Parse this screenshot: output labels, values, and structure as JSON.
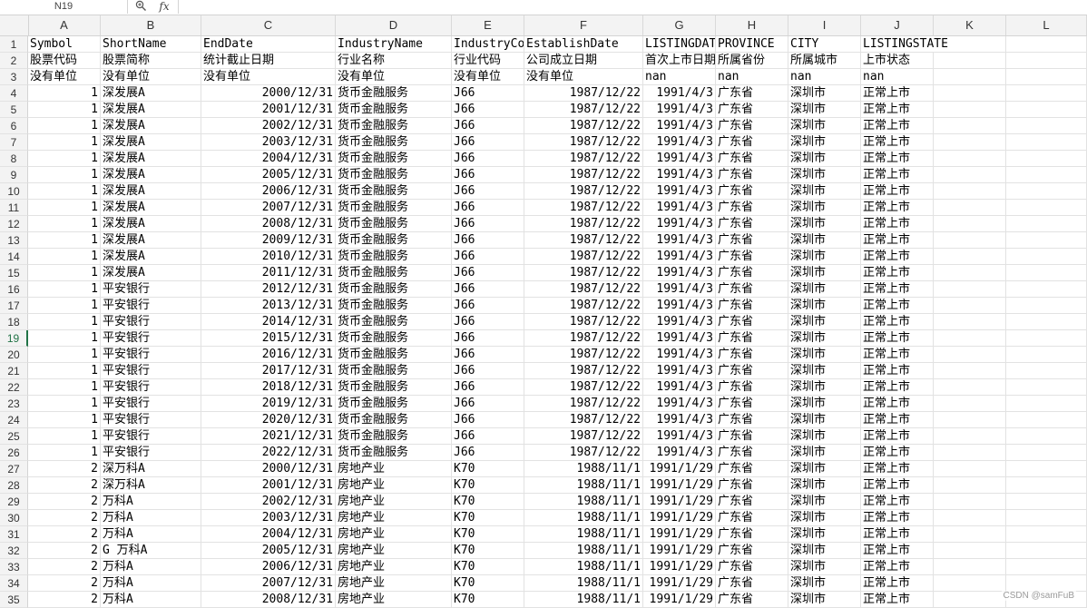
{
  "formula_bar": {
    "name_box": "N19",
    "zoom_icon": "zoom-icon",
    "fx_label": "fx",
    "value": ""
  },
  "columns": [
    "A",
    "B",
    "C",
    "D",
    "E",
    "F",
    "G",
    "H",
    "I",
    "J",
    "K",
    "L"
  ],
  "selected_row": 19,
  "watermark": "CSDN @samFuB",
  "rows": [
    [
      "Symbol",
      "ShortName",
      "EndDate",
      "IndustryName",
      "IndustryCode",
      "EstablishDate",
      "LISTINGDATE",
      "PROVINCE",
      "CITY",
      "LISTINGSTATE"
    ],
    [
      "股票代码",
      "股票简称",
      "统计截止日期",
      "行业名称",
      "行业代码",
      "公司成立日期",
      "首次上市日期",
      "所属省份",
      "所属城市",
      "上市状态"
    ],
    [
      "没有单位",
      "没有单位",
      "没有单位",
      "没有单位",
      "没有单位",
      "没有单位",
      "nan",
      "nan",
      "nan",
      "nan"
    ],
    [
      "1",
      "深发展A",
      "2000/12/31",
      "货币金融服务",
      "J66",
      "1987/12/22",
      "1991/4/3",
      "广东省",
      "深圳市",
      "正常上市"
    ],
    [
      "1",
      "深发展A",
      "2001/12/31",
      "货币金融服务",
      "J66",
      "1987/12/22",
      "1991/4/3",
      "广东省",
      "深圳市",
      "正常上市"
    ],
    [
      "1",
      "深发展A",
      "2002/12/31",
      "货币金融服务",
      "J66",
      "1987/12/22",
      "1991/4/3",
      "广东省",
      "深圳市",
      "正常上市"
    ],
    [
      "1",
      "深发展A",
      "2003/12/31",
      "货币金融服务",
      "J66",
      "1987/12/22",
      "1991/4/3",
      "广东省",
      "深圳市",
      "正常上市"
    ],
    [
      "1",
      "深发展A",
      "2004/12/31",
      "货币金融服务",
      "J66",
      "1987/12/22",
      "1991/4/3",
      "广东省",
      "深圳市",
      "正常上市"
    ],
    [
      "1",
      "深发展A",
      "2005/12/31",
      "货币金融服务",
      "J66",
      "1987/12/22",
      "1991/4/3",
      "广东省",
      "深圳市",
      "正常上市"
    ],
    [
      "1",
      "深发展A",
      "2006/12/31",
      "货币金融服务",
      "J66",
      "1987/12/22",
      "1991/4/3",
      "广东省",
      "深圳市",
      "正常上市"
    ],
    [
      "1",
      "深发展A",
      "2007/12/31",
      "货币金融服务",
      "J66",
      "1987/12/22",
      "1991/4/3",
      "广东省",
      "深圳市",
      "正常上市"
    ],
    [
      "1",
      "深发展A",
      "2008/12/31",
      "货币金融服务",
      "J66",
      "1987/12/22",
      "1991/4/3",
      "广东省",
      "深圳市",
      "正常上市"
    ],
    [
      "1",
      "深发展A",
      "2009/12/31",
      "货币金融服务",
      "J66",
      "1987/12/22",
      "1991/4/3",
      "广东省",
      "深圳市",
      "正常上市"
    ],
    [
      "1",
      "深发展A",
      "2010/12/31",
      "货币金融服务",
      "J66",
      "1987/12/22",
      "1991/4/3",
      "广东省",
      "深圳市",
      "正常上市"
    ],
    [
      "1",
      "深发展A",
      "2011/12/31",
      "货币金融服务",
      "J66",
      "1987/12/22",
      "1991/4/3",
      "广东省",
      "深圳市",
      "正常上市"
    ],
    [
      "1",
      "平安银行",
      "2012/12/31",
      "货币金融服务",
      "J66",
      "1987/12/22",
      "1991/4/3",
      "广东省",
      "深圳市",
      "正常上市"
    ],
    [
      "1",
      "平安银行",
      "2013/12/31",
      "货币金融服务",
      "J66",
      "1987/12/22",
      "1991/4/3",
      "广东省",
      "深圳市",
      "正常上市"
    ],
    [
      "1",
      "平安银行",
      "2014/12/31",
      "货币金融服务",
      "J66",
      "1987/12/22",
      "1991/4/3",
      "广东省",
      "深圳市",
      "正常上市"
    ],
    [
      "1",
      "平安银行",
      "2015/12/31",
      "货币金融服务",
      "J66",
      "1987/12/22",
      "1991/4/3",
      "广东省",
      "深圳市",
      "正常上市"
    ],
    [
      "1",
      "平安银行",
      "2016/12/31",
      "货币金融服务",
      "J66",
      "1987/12/22",
      "1991/4/3",
      "广东省",
      "深圳市",
      "正常上市"
    ],
    [
      "1",
      "平安银行",
      "2017/12/31",
      "货币金融服务",
      "J66",
      "1987/12/22",
      "1991/4/3",
      "广东省",
      "深圳市",
      "正常上市"
    ],
    [
      "1",
      "平安银行",
      "2018/12/31",
      "货币金融服务",
      "J66",
      "1987/12/22",
      "1991/4/3",
      "广东省",
      "深圳市",
      "正常上市"
    ],
    [
      "1",
      "平安银行",
      "2019/12/31",
      "货币金融服务",
      "J66",
      "1987/12/22",
      "1991/4/3",
      "广东省",
      "深圳市",
      "正常上市"
    ],
    [
      "1",
      "平安银行",
      "2020/12/31",
      "货币金融服务",
      "J66",
      "1987/12/22",
      "1991/4/3",
      "广东省",
      "深圳市",
      "正常上市"
    ],
    [
      "1",
      "平安银行",
      "2021/12/31",
      "货币金融服务",
      "J66",
      "1987/12/22",
      "1991/4/3",
      "广东省",
      "深圳市",
      "正常上市"
    ],
    [
      "1",
      "平安银行",
      "2022/12/31",
      "货币金融服务",
      "J66",
      "1987/12/22",
      "1991/4/3",
      "广东省",
      "深圳市",
      "正常上市"
    ],
    [
      "2",
      "深万科A",
      "2000/12/31",
      "房地产业",
      "K70",
      "1988/11/1",
      "1991/1/29",
      "广东省",
      "深圳市",
      "正常上市"
    ],
    [
      "2",
      "深万科A",
      "2001/12/31",
      "房地产业",
      "K70",
      "1988/11/1",
      "1991/1/29",
      "广东省",
      "深圳市",
      "正常上市"
    ],
    [
      "2",
      "万科A",
      "2002/12/31",
      "房地产业",
      "K70",
      "1988/11/1",
      "1991/1/29",
      "广东省",
      "深圳市",
      "正常上市"
    ],
    [
      "2",
      "万科A",
      "2003/12/31",
      "房地产业",
      "K70",
      "1988/11/1",
      "1991/1/29",
      "广东省",
      "深圳市",
      "正常上市"
    ],
    [
      "2",
      "万科A",
      "2004/12/31",
      "房地产业",
      "K70",
      "1988/11/1",
      "1991/1/29",
      "广东省",
      "深圳市",
      "正常上市"
    ],
    [
      "2",
      "G 万科A",
      "2005/12/31",
      "房地产业",
      "K70",
      "1988/11/1",
      "1991/1/29",
      "广东省",
      "深圳市",
      "正常上市"
    ],
    [
      "2",
      "万科A",
      "2006/12/31",
      "房地产业",
      "K70",
      "1988/11/1",
      "1991/1/29",
      "广东省",
      "深圳市",
      "正常上市"
    ],
    [
      "2",
      "万科A",
      "2007/12/31",
      "房地产业",
      "K70",
      "1988/11/1",
      "1991/1/29",
      "广东省",
      "深圳市",
      "正常上市"
    ],
    [
      "2",
      "万科A",
      "2008/12/31",
      "房地产业",
      "K70",
      "1988/11/1",
      "1991/1/29",
      "广东省",
      "深圳市",
      "正常上市"
    ]
  ]
}
